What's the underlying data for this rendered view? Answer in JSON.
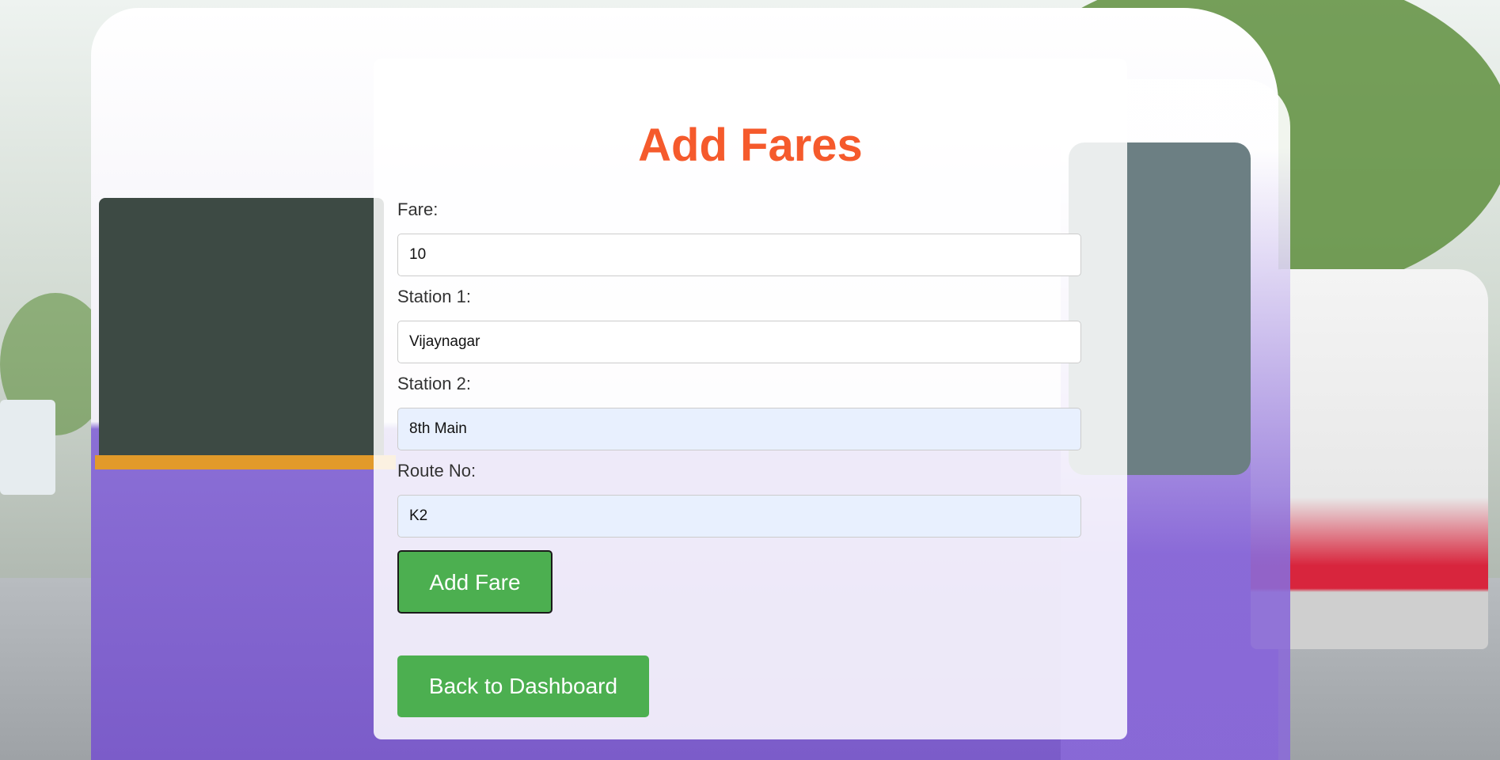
{
  "page": {
    "title": "Add Fares"
  },
  "form": {
    "fare": {
      "label": "Fare:",
      "value": "10"
    },
    "station1": {
      "label": "Station 1:",
      "value": "Vijaynagar"
    },
    "station2": {
      "label": "Station 2:",
      "value": "8th Main"
    },
    "route_no": {
      "label": "Route No:",
      "value": "K2"
    },
    "submit_label": "Add Fare"
  },
  "nav": {
    "back_label": "Back to Dashboard"
  },
  "colors": {
    "title": "#f55a2c",
    "button": "#4caf50",
    "autofill_bg": "#e8f0fe"
  }
}
